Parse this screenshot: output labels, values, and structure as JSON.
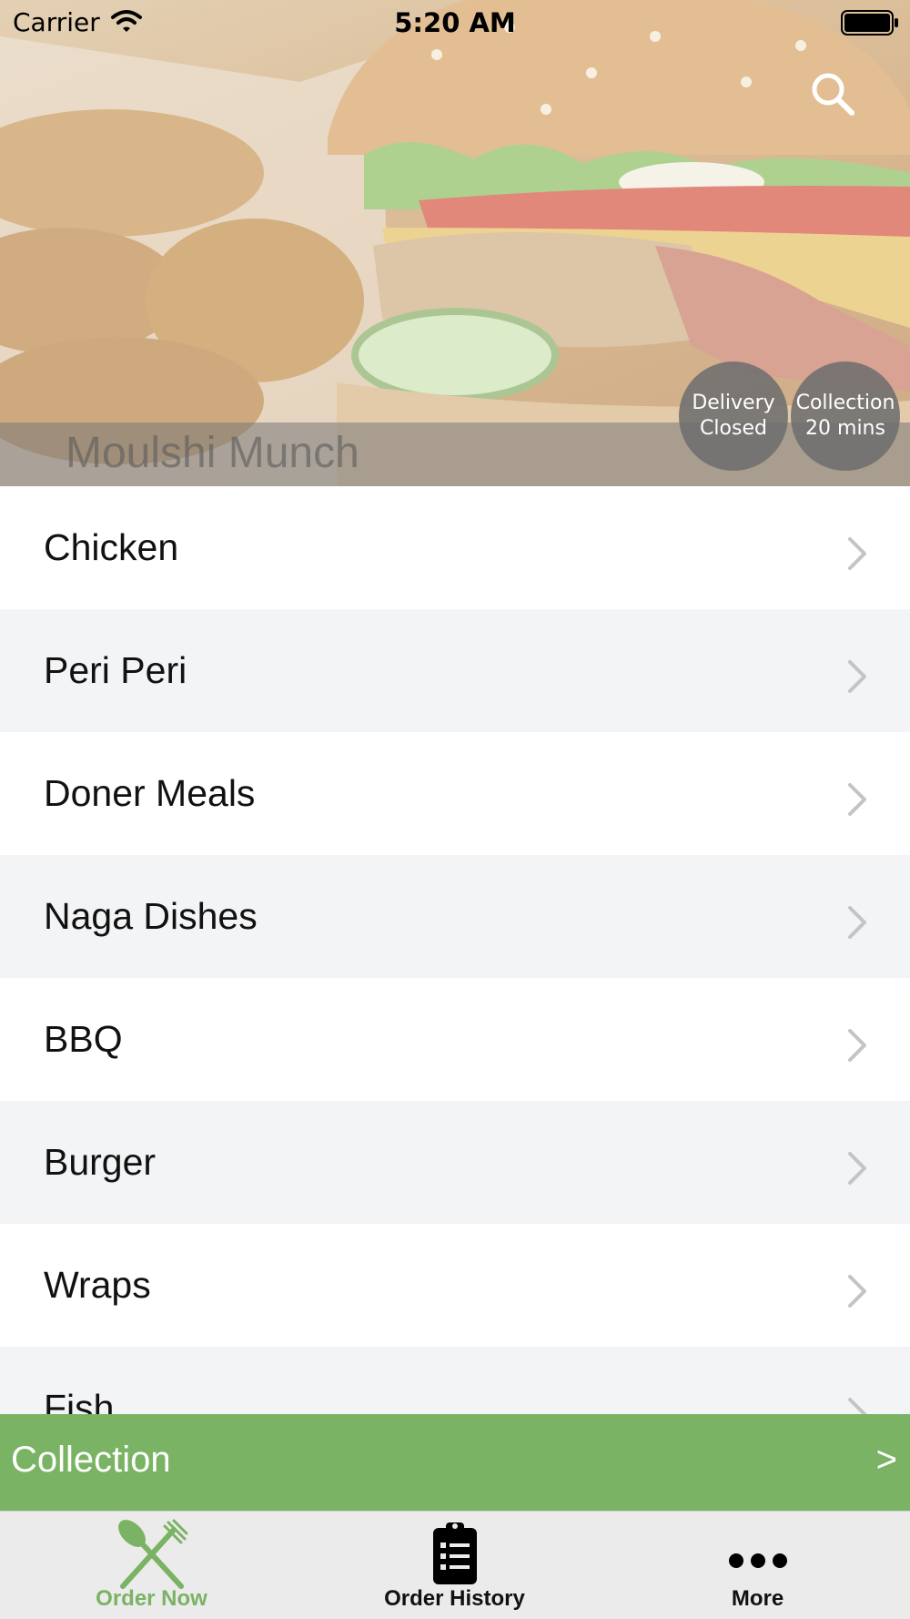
{
  "status_bar": {
    "carrier": "Carrier",
    "time": "5:20 AM",
    "wifi_icon": "wifi-icon",
    "battery_icon": "battery-icon"
  },
  "header": {
    "restaurant_name": "Moulshi Munch",
    "search_icon": "search-icon",
    "badges": {
      "delivery": {
        "line1": "Delivery",
        "line2": "Closed"
      },
      "collection": {
        "line1": "Collection",
        "line2": "20 mins"
      }
    }
  },
  "menu": {
    "items": [
      {
        "label": "Chicken"
      },
      {
        "label": "Peri Peri"
      },
      {
        "label": "Doner Meals"
      },
      {
        "label": "Naga Dishes"
      },
      {
        "label": "BBQ"
      },
      {
        "label": "Burger"
      },
      {
        "label": "Wraps"
      },
      {
        "label": "Fish"
      }
    ],
    "chevron_icon": "chevron-right-icon"
  },
  "order_mode_bar": {
    "label": "Collection",
    "arrow": ">"
  },
  "tab_bar": {
    "tabs": [
      {
        "label": "Order Now",
        "icon": "fork-knife-icon",
        "active": true
      },
      {
        "label": "Order History",
        "icon": "clipboard-icon",
        "active": false
      },
      {
        "label": "More",
        "icon": "more-dots-icon",
        "active": false
      }
    ]
  },
  "colors": {
    "accent_green": "#7ab363",
    "alt_row": "#f3f4f6",
    "badge_gray": "#6e6e6e"
  }
}
